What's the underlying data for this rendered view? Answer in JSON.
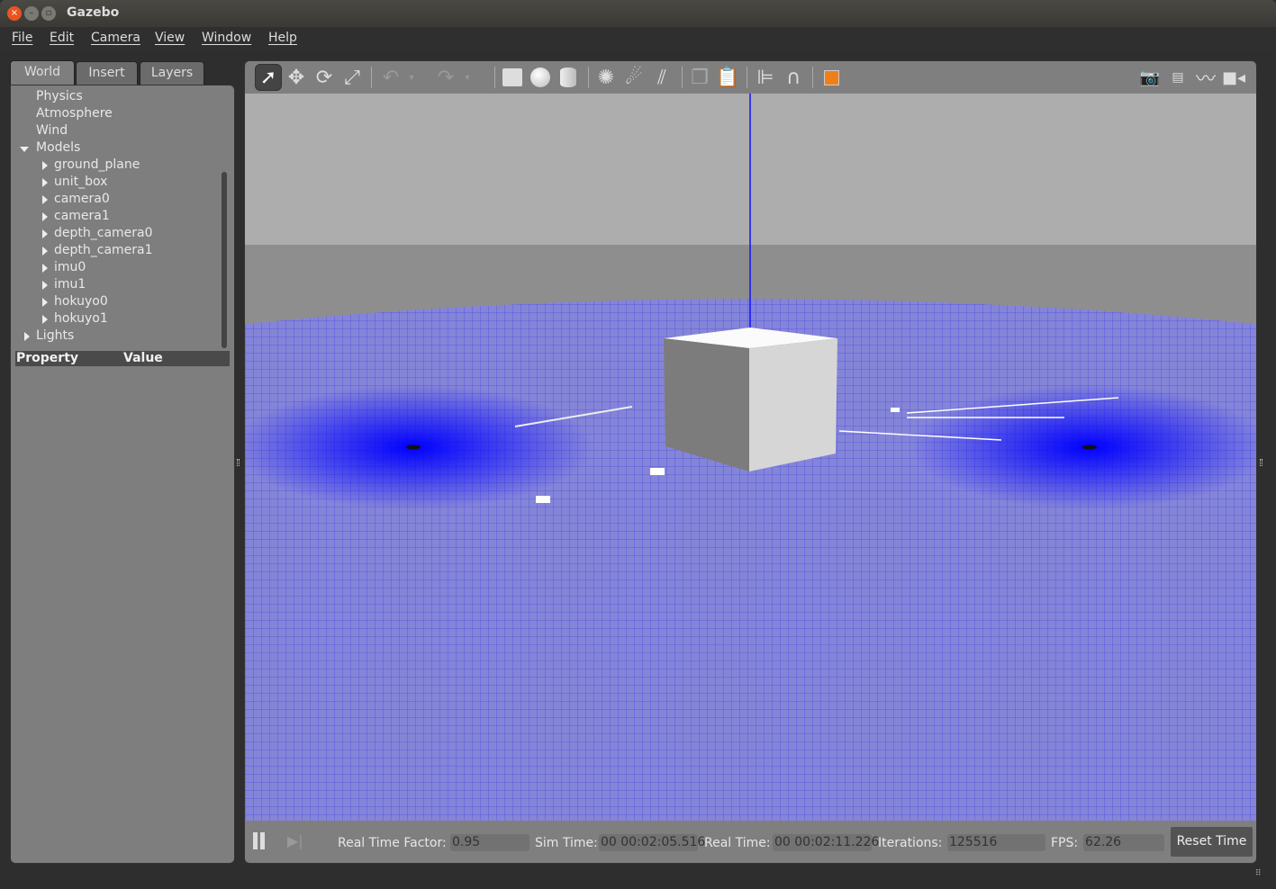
{
  "window": {
    "title": "Gazebo"
  },
  "menu": [
    "File",
    "Edit",
    "Camera",
    "View",
    "Window",
    "Help"
  ],
  "tabs": [
    "World",
    "Insert",
    "Layers"
  ],
  "tree": {
    "top": [
      "Physics",
      "Atmosphere",
      "Wind"
    ],
    "models_label": "Models",
    "models": [
      "ground_plane",
      "unit_box",
      "camera0",
      "camera1",
      "depth_camera0",
      "depth_camera1",
      "imu0",
      "imu1",
      "hokuyo0",
      "hokuyo1"
    ],
    "lights_label": "Lights"
  },
  "properties": {
    "col1": "Property",
    "col2": "Value"
  },
  "toolbar": {
    "icons": [
      "select-arrow",
      "translate",
      "rotate",
      "scale",
      "undo",
      "redo",
      "box",
      "sphere",
      "cylinder",
      "point-light",
      "spot-light",
      "directional-light",
      "copy",
      "paste",
      "align",
      "snap",
      "view-angle",
      "screenshot",
      "log",
      "plot",
      "record-video"
    ],
    "accent": "#f07f1a"
  },
  "status": {
    "rtf_label": "Real Time Factor:",
    "rtf": "0.95",
    "sim_label": "Sim Time:",
    "sim": "00 00:02:05.516",
    "real_label": "Real Time:",
    "real": "00 00:02:11.226",
    "iter_label": "Iterations:",
    "iter": "125516",
    "fps_label": "FPS:",
    "fps": "62.26",
    "reset_label": "Reset Time"
  }
}
